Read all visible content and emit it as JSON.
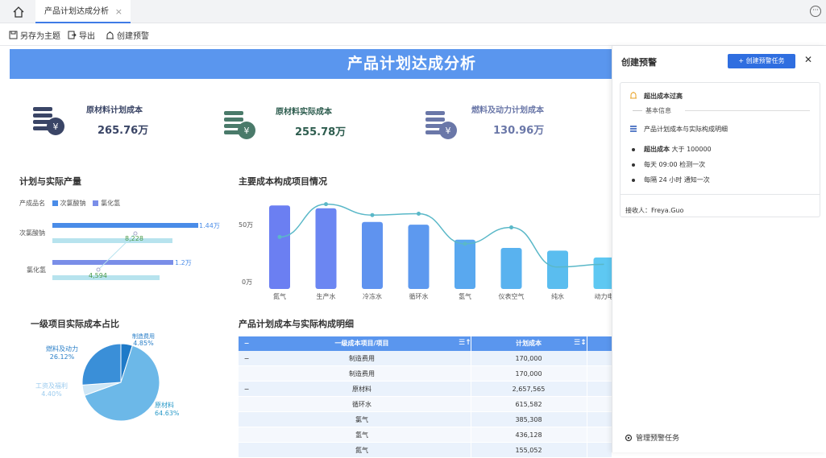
{
  "tabs": [
    {
      "label": "产品计划达成分析",
      "close": "×"
    }
  ],
  "more_label": "···",
  "toolbar": {
    "save_theme": "另存为主题",
    "export": "导出",
    "create_alert": "创建预警"
  },
  "banner_title": "产品计划达成分析",
  "kpis": [
    {
      "label": "原材料计划成本",
      "value": "265.76万",
      "color": "#3a4566"
    },
    {
      "label": "原材料实际成本",
      "value": "255.78万",
      "color": "#2e5d4f"
    },
    {
      "label": "燃料及动力计划成本",
      "value": "130.96万",
      "color": "#6a77a8"
    }
  ],
  "production": {
    "title": "计划与实际产量",
    "legend_label": "产成品名",
    "legend": [
      {
        "name": "次氯酸钠",
        "color": "#4a8ce8"
      },
      {
        "name": "氯化氢",
        "color": "#7a8ee8"
      }
    ],
    "rows": [
      {
        "name": "次氯酸钠",
        "plan_label": "1.44万",
        "actual_label": "8,228"
      },
      {
        "name": "氯化氢",
        "plan_label": "1.2万",
        "actual_label": "4,594"
      }
    ]
  },
  "chart_data": [
    {
      "type": "bar",
      "title": "主要成本构成项目情况",
      "categories": [
        "氮气",
        "生产水",
        "冷冻水",
        "循环水",
        "氢气",
        "仪表空气",
        "纯水",
        "动力电"
      ],
      "values": [
        61,
        59,
        49,
        47,
        36,
        30,
        28,
        23
      ],
      "line_values": [
        38,
        62,
        54,
        55,
        33,
        45,
        16,
        18
      ],
      "y_ticks": [
        "50万",
        "0万"
      ],
      "ylim": [
        0,
        70
      ]
    },
    {
      "type": "pie",
      "title": "一级项目实际成本占比",
      "slices": [
        {
          "name": "原材料",
          "pct": "64.63%",
          "value": 64.63,
          "color": "#6cb8e8"
        },
        {
          "name": "工资及福利",
          "pct": "4.40%",
          "value": 4.4,
          "color": "#cde6f6"
        },
        {
          "name": "燃料及动力",
          "pct": "26.12%",
          "value": 26.12,
          "color": "#3a8fd8"
        },
        {
          "name": "制造费用",
          "pct": "4.85%",
          "value": 4.85,
          "color": "#1e7ac8"
        }
      ]
    }
  ],
  "table": {
    "title": "产品计划成本与实际构成明细",
    "columns": [
      "一级成本项目/项目",
      "计划成本"
    ],
    "collapse_icon": "−",
    "rows": [
      {
        "toggle": "−",
        "name": "制造费用",
        "plan": "170,000"
      },
      {
        "toggle": "",
        "name": "制造费用",
        "plan": "170,000"
      },
      {
        "toggle": "−",
        "name": "原材料",
        "plan": "2,657,565"
      },
      {
        "toggle": "",
        "name": "循环水",
        "plan": "615,582"
      },
      {
        "toggle": "",
        "name": "氯气",
        "plan": "385,308"
      },
      {
        "toggle": "",
        "name": "氢气",
        "plan": "436,128"
      },
      {
        "toggle": "",
        "name": "氮气",
        "plan": "155,052"
      }
    ]
  },
  "alert_panel": {
    "title": "创建预警",
    "create_button": "+ 创建预警任务",
    "close": "✕",
    "task_name": "超出成本过高",
    "section_label": "基本信息",
    "table_ref": "产品计划成本与实际构成明细",
    "rule_bold": "超出成本",
    "rule_rest": "大于 100000",
    "schedule": "每天 09:00 检测一次",
    "notify": "每隔 24 小时 通知一次",
    "receiver": "接收人：Freya.Guo",
    "manage": "管理预警任务"
  }
}
